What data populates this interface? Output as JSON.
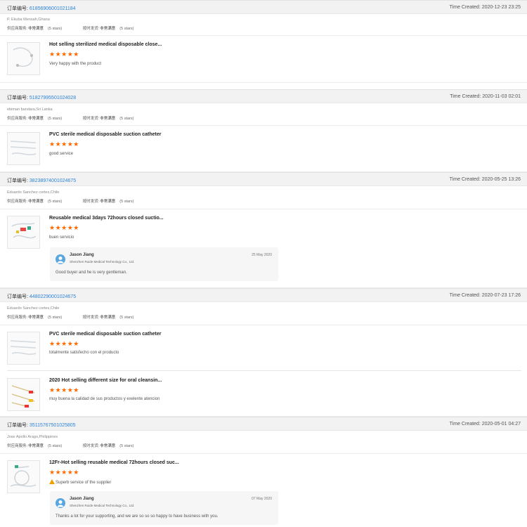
{
  "labels": {
    "order_no": "订单编号:",
    "time_created": "Time Created:",
    "supplier_service": "供应商服务:",
    "on_time": "按时发货:",
    "very_satisfied": "非常满意",
    "five_stars": "(5 stars)"
  },
  "stars": "★★★★★",
  "orders": [
    {
      "id": "61856906001021184",
      "time": "2020-12-23 23:25",
      "buyer": "P. Ekuba Mensah,Ghana",
      "items": [
        {
          "title": "Hot selling sterilized medical disposable close...",
          "rating": 5,
          "comment": "Very happy with the product",
          "thumb_icon": "product-image-icon"
        }
      ]
    },
    {
      "id": "51827995501024028",
      "time": "2020-11-03 02:01",
      "buyer": "ebiman bandara,Sri Lanka",
      "items": [
        {
          "title": "PVC sterile medical disposable suction catheter",
          "rating": 5,
          "comment": "good service",
          "thumb_icon": "product-image-icon"
        }
      ]
    },
    {
      "id": "38238974001024675",
      "time": "2020-05-25 13:26",
      "buyer": "Eduardo Sanchez cortes,Chile",
      "items": [
        {
          "title": "Reusable medical 3days 72hours closed suctio...",
          "rating": 5,
          "comment": "buen servicio",
          "thumb_icon": "product-image-icon"
        }
      ],
      "reply": {
        "name": "Jason Jiang",
        "company": "Shenzhen Ruide Medical Technology Co., Ltd.",
        "date": "25 May 2020",
        "text": "Good buyer and he is very gentleman."
      }
    },
    {
      "id": "44802290001024675",
      "time": "2020-07-23 17:26",
      "buyer": "Eduardo Sanchez cortes,Chile",
      "items": [
        {
          "title": "PVC sterile medical disposable suction catheter",
          "rating": 5,
          "comment": "totalmente satisfecho con el producto",
          "thumb_icon": "product-image-icon"
        },
        {
          "title": "2020 Hot selling different size for oral cleansin...",
          "rating": 5,
          "comment": "muy buena la calidad de sus productos y exelente atencion",
          "thumb_icon": "product-image-icon"
        }
      ]
    },
    {
      "id": "35115767501025805",
      "time": "2020-05-01 04:27",
      "buyer": "Jose Apollo Arago,Philippines",
      "items": [
        {
          "title": "12Fr-Hot selling reusable medical 72hours closed suc...",
          "rating": 5,
          "comment": "Superb service of the supplier",
          "thumb_icon": "product-image-icon",
          "warn_icon": "warning-icon"
        }
      ],
      "reply": {
        "name": "Jason Jiang",
        "company": "Shenzhen Ruide Medical Technology Co., Ltd.",
        "date": "07 May 2020",
        "text": "Thanks a lot for your supporting, and we are so so so happy to have business with you."
      }
    }
  ]
}
